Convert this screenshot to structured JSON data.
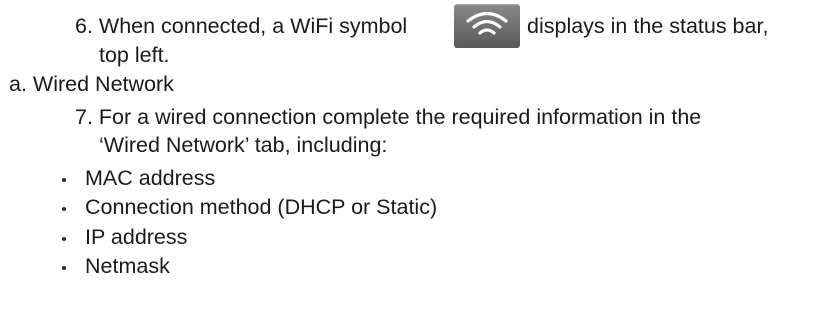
{
  "step6": {
    "marker": "6.",
    "text_before_icon": "When connected, a WiFi symbol",
    "text_after_icon": "displays in the status bar,",
    "continuation": "top left.",
    "icon": "wifi-icon"
  },
  "section_a": {
    "marker": "a.",
    "title": "Wired Network"
  },
  "step7": {
    "marker": "7.",
    "line1": "For a wired connection complete the required information in the",
    "line2": "‘Wired Network’ tab, including:"
  },
  "bullets": [
    {
      "text": "MAC address"
    },
    {
      "text": "Connection method (DHCP or Static)"
    },
    {
      "text": "IP address"
    },
    {
      "text": "Netmask"
    }
  ]
}
